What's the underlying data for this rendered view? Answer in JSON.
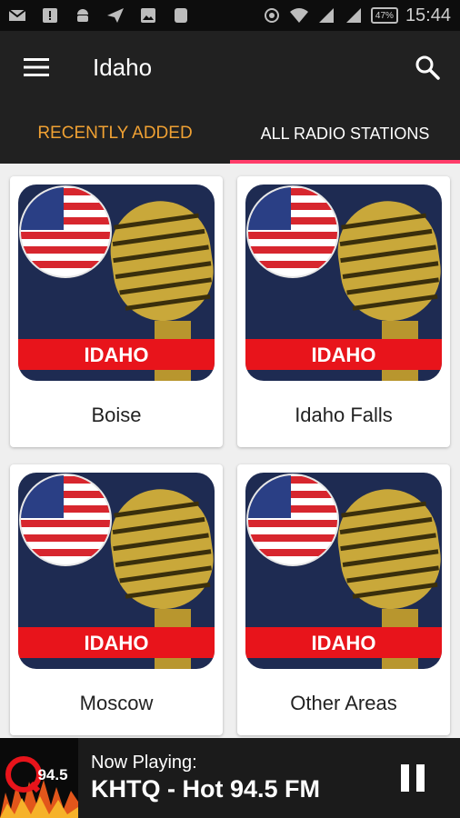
{
  "status_bar": {
    "time": "15:44",
    "battery": "47%"
  },
  "toolbar": {
    "title": "Idaho"
  },
  "tabs": [
    {
      "label": "RECENTLY ADDED",
      "active": true
    },
    {
      "label": "ALL RADIO STATIONS",
      "active": false
    }
  ],
  "cards": [
    {
      "badge": "IDAHO",
      "label": "Boise"
    },
    {
      "badge": "IDAHO",
      "label": "Idaho Falls"
    },
    {
      "badge": "IDAHO",
      "label": "Moscow"
    },
    {
      "badge": "IDAHO",
      "label": "Other Areas"
    }
  ],
  "now_playing": {
    "label": "Now Playing:",
    "station": "KHTQ - Hot 94.5 FM",
    "logo_text": "94.5"
  },
  "colors": {
    "accent_tab": "#f0a133",
    "indicator": "#ff3d6a",
    "toolbar": "#212121",
    "badge_red": "#e8141b",
    "card_bg": "#1e2b52"
  }
}
